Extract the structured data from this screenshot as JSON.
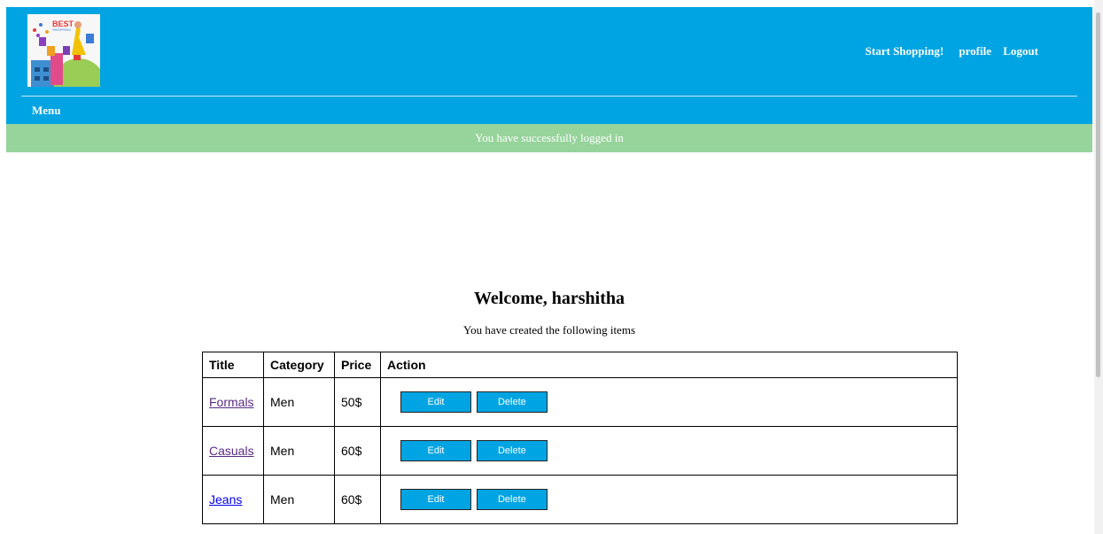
{
  "header": {
    "logo_text": "BEST SHOPPING",
    "nav": {
      "start_shopping": "Start Shopping!",
      "profile": "profile",
      "logout": "Logout"
    },
    "menu_label": "Menu"
  },
  "banner": {
    "message": "You have successfully logged in"
  },
  "main": {
    "welcome": "Welcome, harshitha",
    "subtitle": "You have created the following items",
    "table": {
      "headers": [
        "Title",
        "Category",
        "Price",
        "Action"
      ],
      "rows": [
        {
          "title": "Formals",
          "category": "Men",
          "price": "50$",
          "edit": "Edit",
          "delete": "Delete"
        },
        {
          "title": "Casuals",
          "category": "Men",
          "price": "60$",
          "edit": "Edit",
          "delete": "Delete"
        },
        {
          "title": "Jeans",
          "category": "Men",
          "price": "60$",
          "edit": "Edit",
          "delete": "Delete"
        }
      ]
    }
  },
  "colors": {
    "header_bg": "#00a4e2",
    "banner_bg": "#97d49b",
    "button_bg": "#00a4e2"
  }
}
